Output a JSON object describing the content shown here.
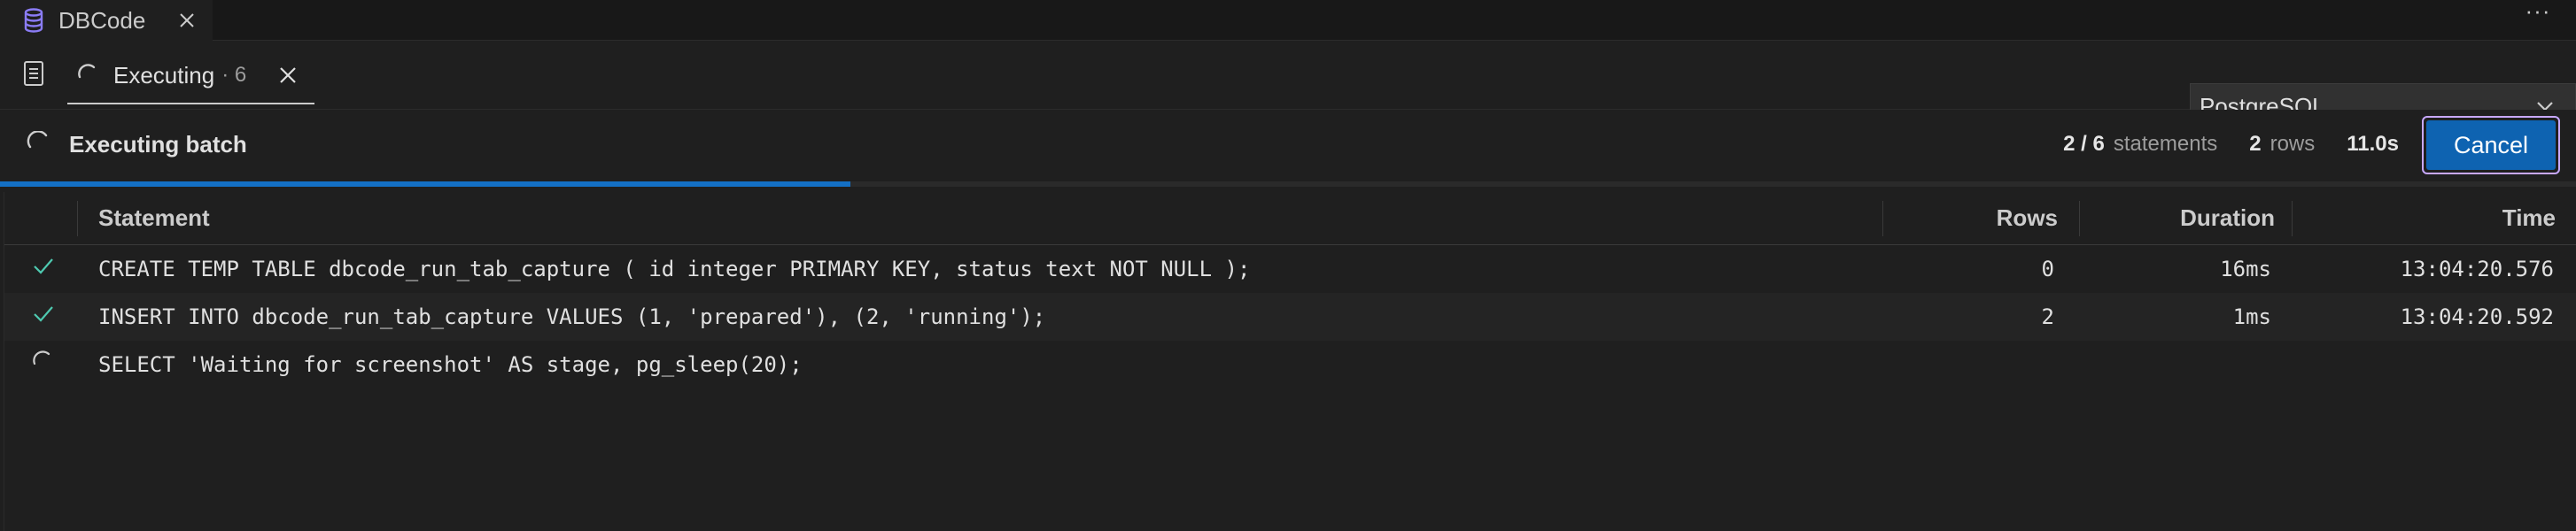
{
  "editor_tab": {
    "title": "DBCode"
  },
  "run_tab": {
    "label": "Executing",
    "count": "· 6"
  },
  "engine_select": {
    "value": "PostgreSQL"
  },
  "status": {
    "text": "Executing batch",
    "statements_done": "2 / 6",
    "statements_unit": "statements",
    "rows_count": "2",
    "rows_unit": "rows",
    "elapsed": "11.0s",
    "cancel_label": "Cancel",
    "progress_fraction": 0.33
  },
  "grid": {
    "columns": {
      "statement": "Statement",
      "rows": "Rows",
      "duration": "Duration",
      "time": "Time"
    },
    "rows": [
      {
        "status": "done",
        "statement": "CREATE TEMP TABLE dbcode_run_tab_capture ( id integer PRIMARY KEY, status text NOT NULL );",
        "rows": "0",
        "duration": "16ms",
        "time": "13:04:20.576"
      },
      {
        "status": "done",
        "statement": "INSERT INTO dbcode_run_tab_capture VALUES (1, 'prepared'), (2, 'running');",
        "rows": "2",
        "duration": "1ms",
        "time": "13:04:20.592"
      },
      {
        "status": "running",
        "statement": "SELECT 'Waiting for screenshot' AS stage, pg_sleep(20);",
        "rows": "",
        "duration": "",
        "time": ""
      }
    ]
  },
  "colors": {
    "accent": "#0e63b1",
    "progress": "#1470c4",
    "success": "#4ec9b0",
    "focus_ring": "#c8a8ff",
    "db_icon": "#8b7cf6"
  },
  "icons": {
    "editor_tab": "database-icon",
    "editor_close": "close-icon",
    "more": "ellipsis-icon",
    "doc": "notebook-icon",
    "spinner": "spinner-icon",
    "run_close": "close-icon",
    "dropdown": "chevron-down-icon",
    "check": "check-icon"
  }
}
